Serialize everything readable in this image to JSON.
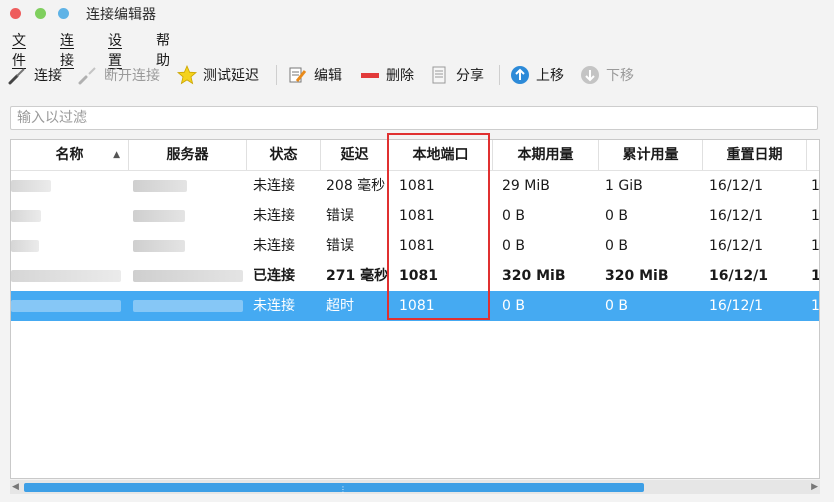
{
  "window": {
    "title": "连接编辑器"
  },
  "menu": [
    "文件",
    "连接",
    "设置",
    "帮助"
  ],
  "toolbar": {
    "connect": "连接",
    "disconnect": "断开连接",
    "test_latency": "测试延迟",
    "edit": "编辑",
    "delete": "删除",
    "share": "分享",
    "move_up": "上移",
    "move_down": "下移"
  },
  "filter": {
    "placeholder": "输入以过滤"
  },
  "table": {
    "columns": [
      "名称",
      "服务器",
      "状态",
      "延迟",
      "本地端口",
      "本期用量",
      "累计用量",
      "重置日期"
    ],
    "sort_indicator": "▲",
    "rows": [
      {
        "status": "未连接",
        "latency": "208 毫秒",
        "port": "1081",
        "period": "29 MiB",
        "total": "1 GiB",
        "reset": "16/12/1",
        "extra": "1"
      },
      {
        "status": "未连接",
        "latency": "错误",
        "port": "1081",
        "period": "0 B",
        "total": "0 B",
        "reset": "16/12/1",
        "extra": "1"
      },
      {
        "status": "未连接",
        "latency": "错误",
        "port": "1081",
        "period": "0 B",
        "total": "0 B",
        "reset": "16/12/1",
        "extra": "1"
      },
      {
        "status": "已连接",
        "latency": "271 毫秒",
        "port": "1081",
        "period": "320 MiB",
        "total": "320 MiB",
        "reset": "16/12/1",
        "extra": "1"
      },
      {
        "status": "未连接",
        "latency": "超时",
        "port": "1081",
        "period": "0 B",
        "total": "0 B",
        "reset": "16/12/1",
        "extra": "1"
      }
    ]
  },
  "colors": {
    "selection": "#45aaf2",
    "highlight_box": "#e03030",
    "scrollbar_thumb": "#3d9fe6"
  },
  "icons": [
    "connect-icon",
    "disconnect-icon",
    "star-icon",
    "edit-icon",
    "delete-icon",
    "share-icon",
    "up-arrow-icon",
    "down-arrow-icon"
  ]
}
